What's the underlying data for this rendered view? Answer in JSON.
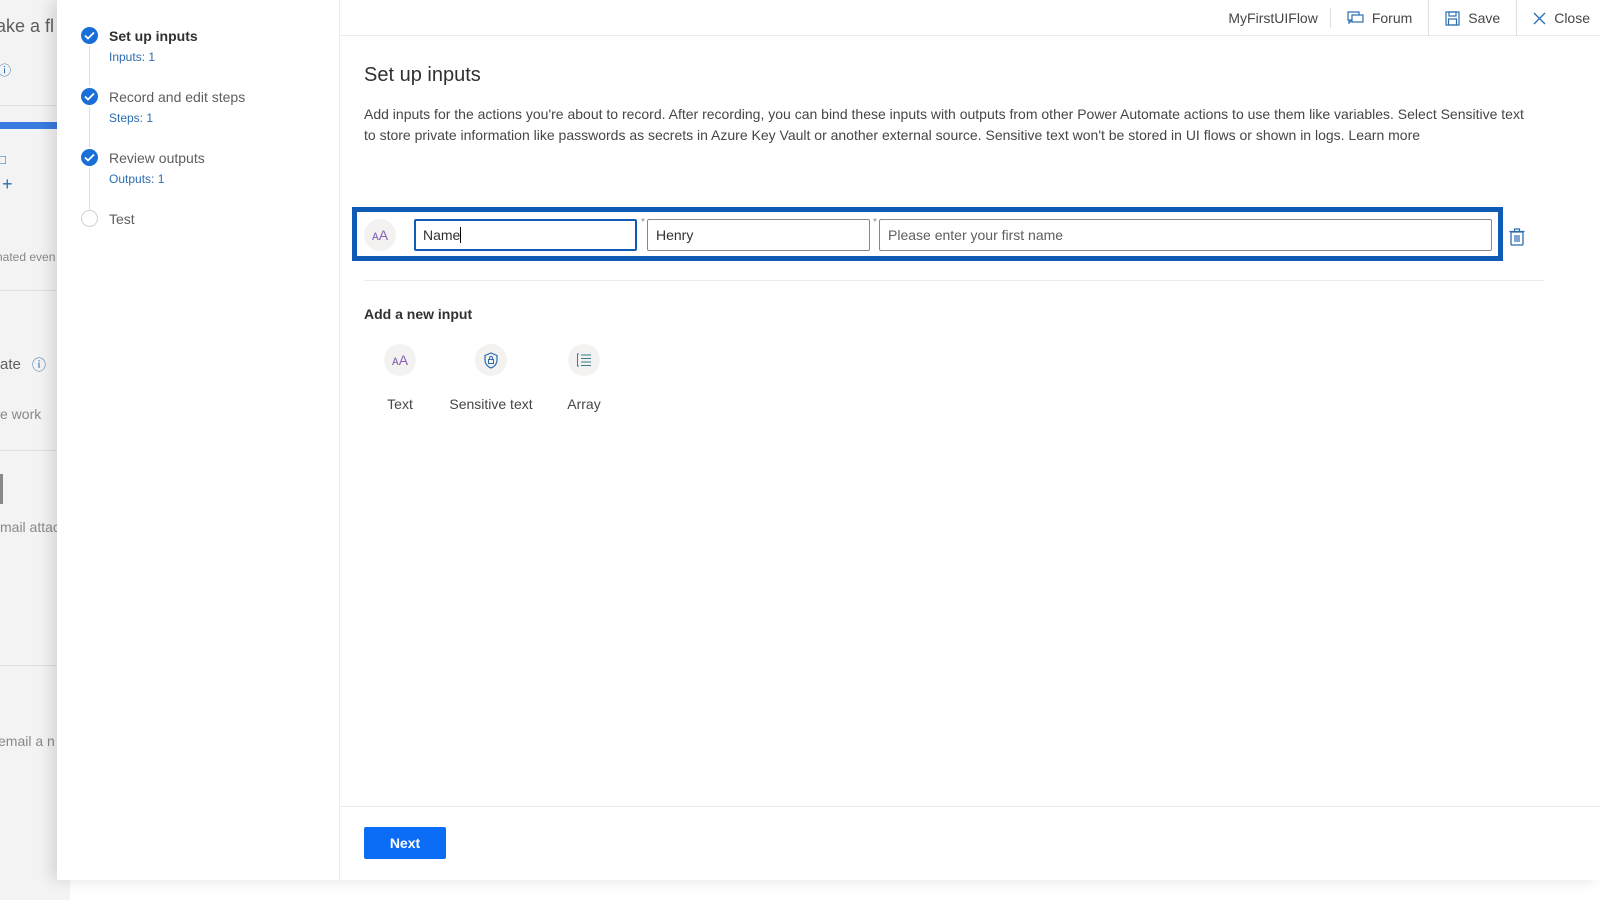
{
  "background": {
    "title_fragment": "ake a fl",
    "snippets": [
      "nated even",
      "ate",
      "e work",
      "mail attac",
      "email a n"
    ]
  },
  "stepper": {
    "steps": [
      {
        "label": "Set up inputs",
        "sub": "Inputs: 1",
        "state": "complete",
        "active": true
      },
      {
        "label": "Record and edit steps",
        "sub": "Steps: 1",
        "state": "complete",
        "active": false
      },
      {
        "label": "Review outputs",
        "sub": "Outputs: 1",
        "state": "complete",
        "active": false
      },
      {
        "label": "Test",
        "sub": "",
        "state": "pending",
        "active": false
      }
    ]
  },
  "header": {
    "flow_name": "MyFirstUIFlow",
    "forum_label": "Forum",
    "save_label": "Save",
    "close_label": "Close"
  },
  "main": {
    "title": "Set up inputs",
    "description": "Add inputs for the actions you're about to record. After recording, you can bind these inputs with outputs from other Power Automate actions to use them like variables. Select Sensitive text to store private information like passwords as secrets in Azure Key Vault or another external source. Sensitive text won't be stored in UI flows or shown in logs. Learn more",
    "input_row": {
      "type_icon": "text-type-icon",
      "name_value": "Name",
      "default_value": "Henry",
      "description_placeholder": "Please enter your first name",
      "required_marker": "*"
    },
    "add_new": {
      "title": "Add a new input",
      "options": [
        {
          "label": "Text",
          "icon": "text-type-icon"
        },
        {
          "label": "Sensitive text",
          "icon": "shield-lock-icon"
        },
        {
          "label": "Array",
          "icon": "list-icon"
        }
      ]
    },
    "next_label": "Next"
  },
  "colors": {
    "accent": "#0b6cf6",
    "step_complete": "#1a6ed8",
    "focus_border": "#0f5bb5",
    "text_icon": "#8764b8"
  }
}
